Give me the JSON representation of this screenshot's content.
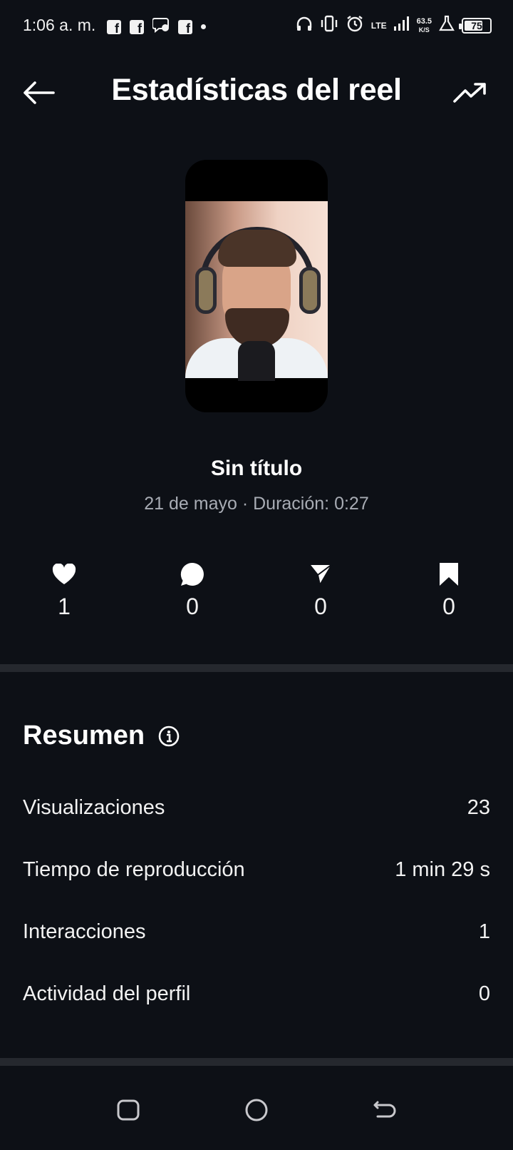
{
  "status_bar": {
    "time": "1:06 a. m.",
    "network": "LTE",
    "speed_value": "63.5",
    "speed_unit": "K/S",
    "battery": "75",
    "battery_level": 0.75
  },
  "header": {
    "title": "Estadísticas del reel",
    "back_icon": "arrow-left-icon",
    "trend_icon": "trending-up-icon"
  },
  "reel": {
    "title": "Sin título",
    "meta": "21 de mayo · Duración: 0:27"
  },
  "engagement": [
    {
      "icon": "heart-icon",
      "count": "1"
    },
    {
      "icon": "comment-icon",
      "count": "0"
    },
    {
      "icon": "share-icon",
      "count": "0"
    },
    {
      "icon": "bookmark-icon",
      "count": "0"
    }
  ],
  "summary": {
    "title": "Resumen",
    "rows": [
      {
        "label": "Visualizaciones",
        "value": "23"
      },
      {
        "label": "Tiempo de reproducción",
        "value": "1 min 29 s"
      },
      {
        "label": "Interacciones",
        "value": "1"
      },
      {
        "label": "Actividad del perfil",
        "value": "0"
      }
    ]
  },
  "colors": {
    "background": "#0d1016",
    "text_primary": "#ffffff",
    "text_secondary": "#a8acb4",
    "divider": "#25282e"
  }
}
